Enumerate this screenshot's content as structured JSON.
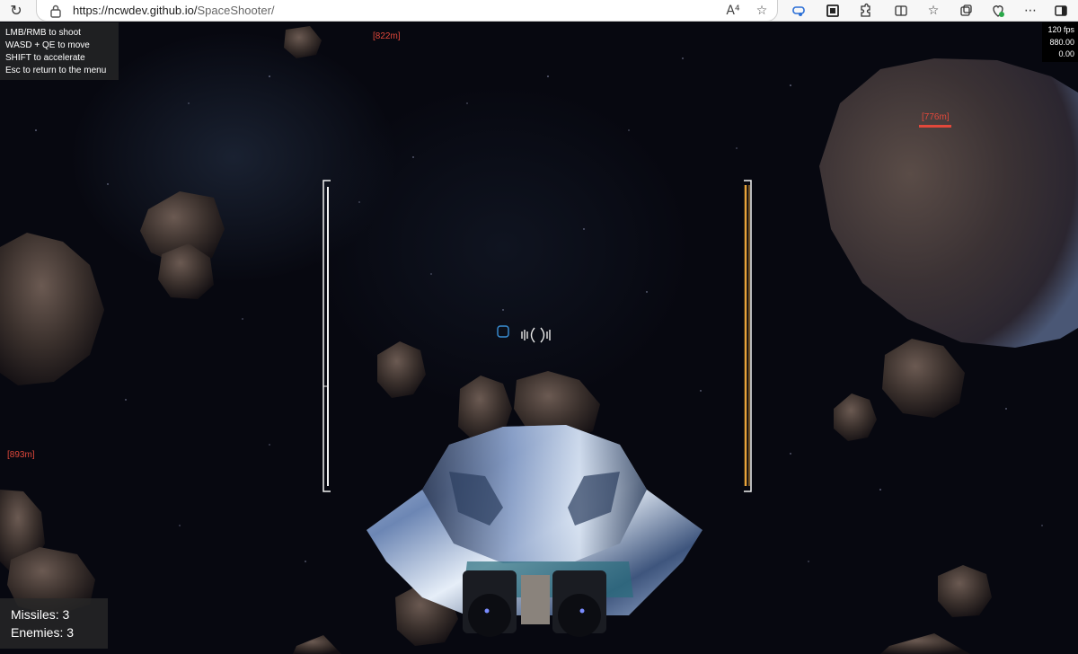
{
  "browser": {
    "url_host": "https://ncwdev.github.io/",
    "url_path": "SpaceShooter/"
  },
  "hud": {
    "help_lines": [
      "LMB/RMB to shoot",
      "WASD + QE to move",
      "SHIFT to accelerate",
      "Esc to return to the menu"
    ],
    "fps": "120 fps",
    "stat_1": "880.00",
    "stat_2": "0.00",
    "missiles_label": "Missiles: 3",
    "enemies_label": "Enemies: 3",
    "distance_markers": [
      "[822m]",
      "[776m]",
      "[893m]"
    ],
    "left_gauge_level": 1.0,
    "right_gauge_level": 1.0
  },
  "colors": {
    "marker": "#e2483b",
    "right_gauge": "#e8a33a",
    "reticle": "#3a8fd6"
  }
}
